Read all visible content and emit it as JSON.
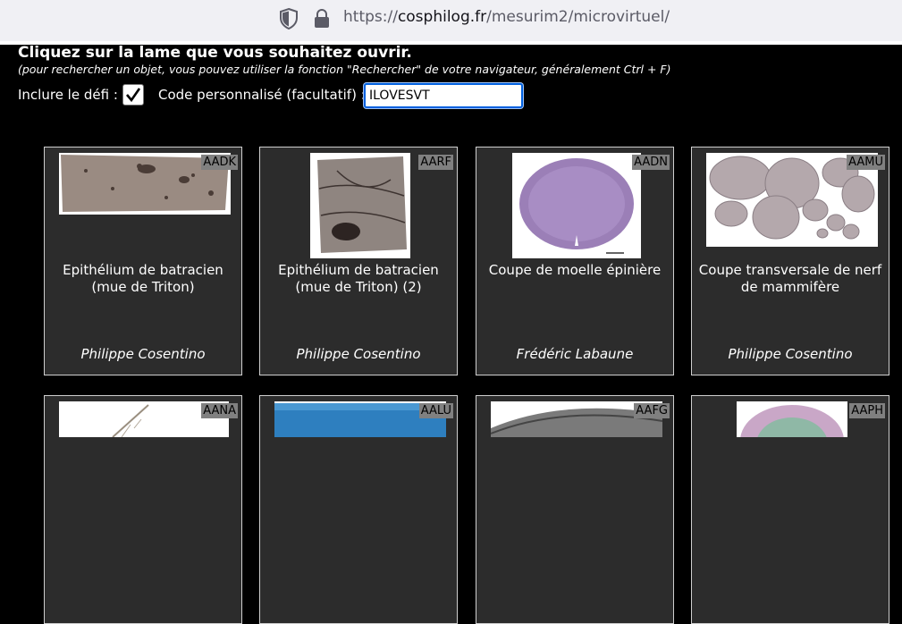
{
  "browser": {
    "url_prefix": "https://",
    "url_host": "cosphilog.fr",
    "url_path": "/mesurim2/microvirtuel/"
  },
  "page": {
    "title": "Cliquez sur la lame que vous souhaitez ouvrir.",
    "subtitle": "(pour rechercher un objet, vous pouvez utiliser la fonction \"Rechercher\" de votre navigateur, généralement Ctrl + F)",
    "include_challenge_label": "Inclure le défi :",
    "include_challenge_checked": true,
    "custom_code_label": "Code personnalisé (facultatif) :",
    "custom_code_value": "ILOVESVT"
  },
  "cards": [
    {
      "code": "AADK",
      "name": "Epithélium de batracien (mue de Triton)",
      "author": "Philippe Cosentino"
    },
    {
      "code": "AARF",
      "name": "Epithélium de batracien (mue de Triton) (2)",
      "author": "Philippe Cosentino"
    },
    {
      "code": "AADN",
      "name": "Coupe de moelle épinière",
      "author": "Frédéric Labaune"
    },
    {
      "code": "AAMU",
      "name": "Coupe transversale de nerf de mammifère",
      "author": "Philippe Cosentino"
    },
    {
      "code": "AANA",
      "name": "",
      "author": ""
    },
    {
      "code": "AALU",
      "name": "",
      "author": ""
    },
    {
      "code": "AAFG",
      "name": "",
      "author": ""
    },
    {
      "code": "AAPH",
      "name": "",
      "author": ""
    }
  ]
}
